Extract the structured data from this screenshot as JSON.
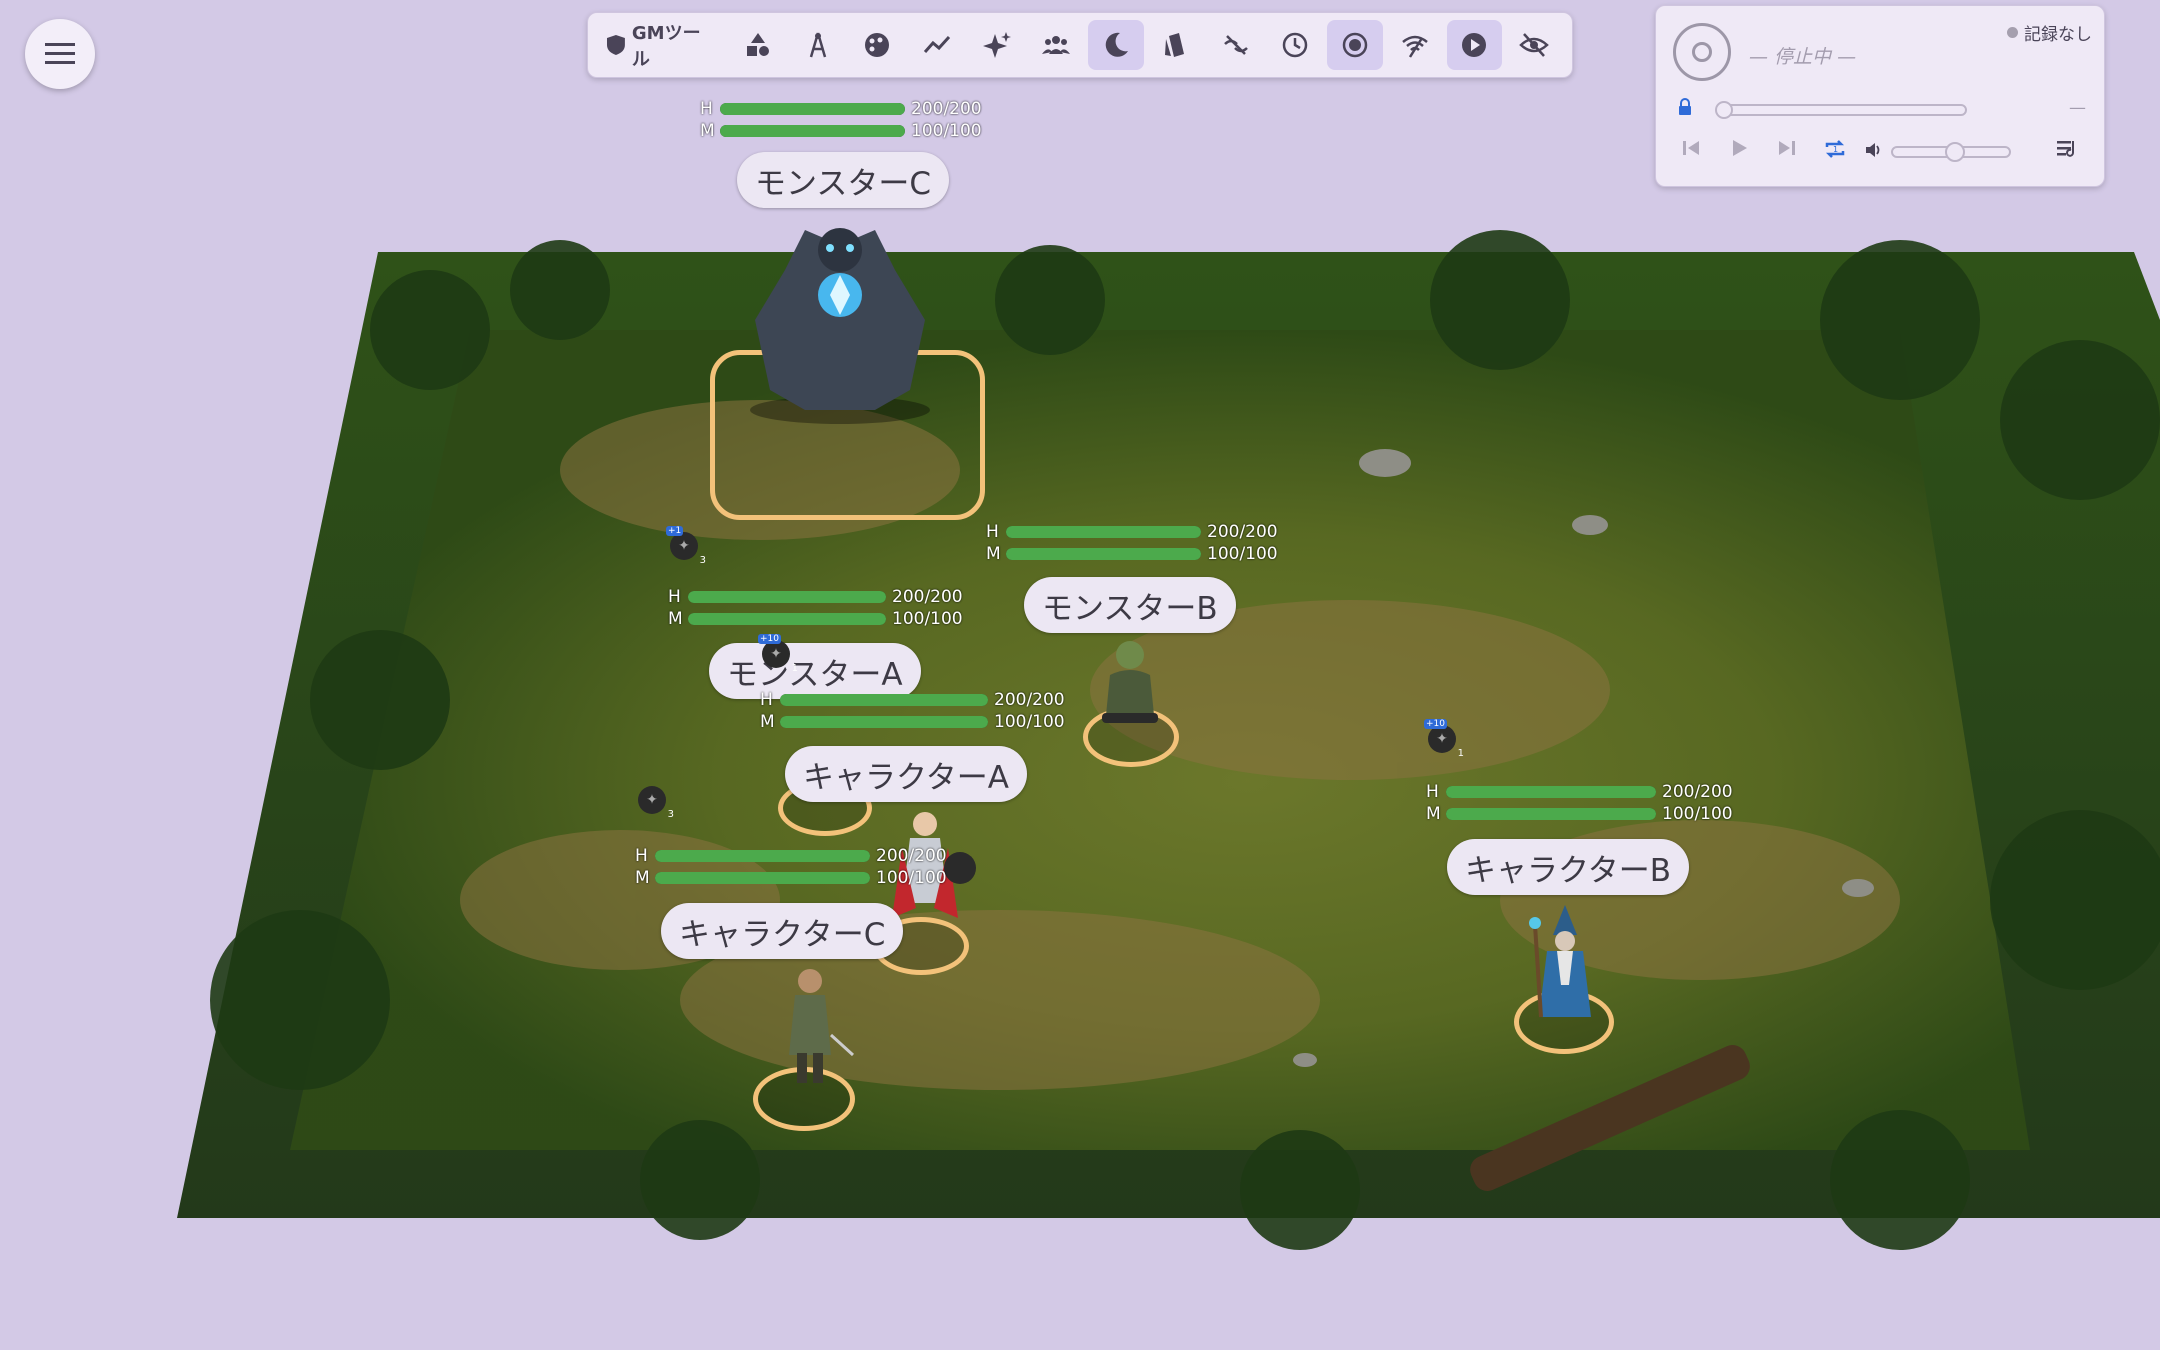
{
  "menu": {
    "icon": "hamburger-menu-icon"
  },
  "toolbar": {
    "gm_label": "GMツール",
    "items": [
      "shapes",
      "pen",
      "palette",
      "trend",
      "sparkle",
      "group",
      "night",
      "cards",
      "eye-off-slash",
      "clock",
      "record",
      "signal",
      "play",
      "visibility-off"
    ],
    "active": [
      "night",
      "record",
      "play"
    ]
  },
  "player": {
    "track": "— 停止中 —",
    "rec_label": "記録なし",
    "time": "—",
    "volume": 0.5,
    "progress": 0
  },
  "tokens": [
    {
      "name": "モンスターC",
      "hp": "200/200",
      "mp": "100/100",
      "hp_frac": 1,
      "mp_frac": 1
    },
    {
      "name": "モンスターB",
      "hp": "200/200",
      "mp": "100/100",
      "hp_frac": 1,
      "mp_frac": 1
    },
    {
      "name": "モンスターA",
      "hp": "200/200",
      "mp": "100/100",
      "hp_frac": 1,
      "mp_frac": 1
    },
    {
      "name": "キャラクターA",
      "hp": "200/200",
      "mp": "100/100",
      "hp_frac": 1,
      "mp_frac": 1
    },
    {
      "name": "キャラクターB",
      "hp": "200/200",
      "mp": "100/100",
      "hp_frac": 1,
      "mp_frac": 1
    },
    {
      "name": "キャラクターC",
      "hp": "200/200",
      "mp": "100/100",
      "hp_frac": 1,
      "mp_frac": 1
    }
  ],
  "labels": {
    "hp": "H",
    "mp": "M"
  },
  "buffs": [
    {
      "tag": "+1",
      "count": "3"
    },
    {
      "tag": "+10",
      "count": "1"
    },
    {
      "tag": "+10",
      "count": "1"
    },
    {
      "tag": "",
      "count": "3"
    }
  ]
}
